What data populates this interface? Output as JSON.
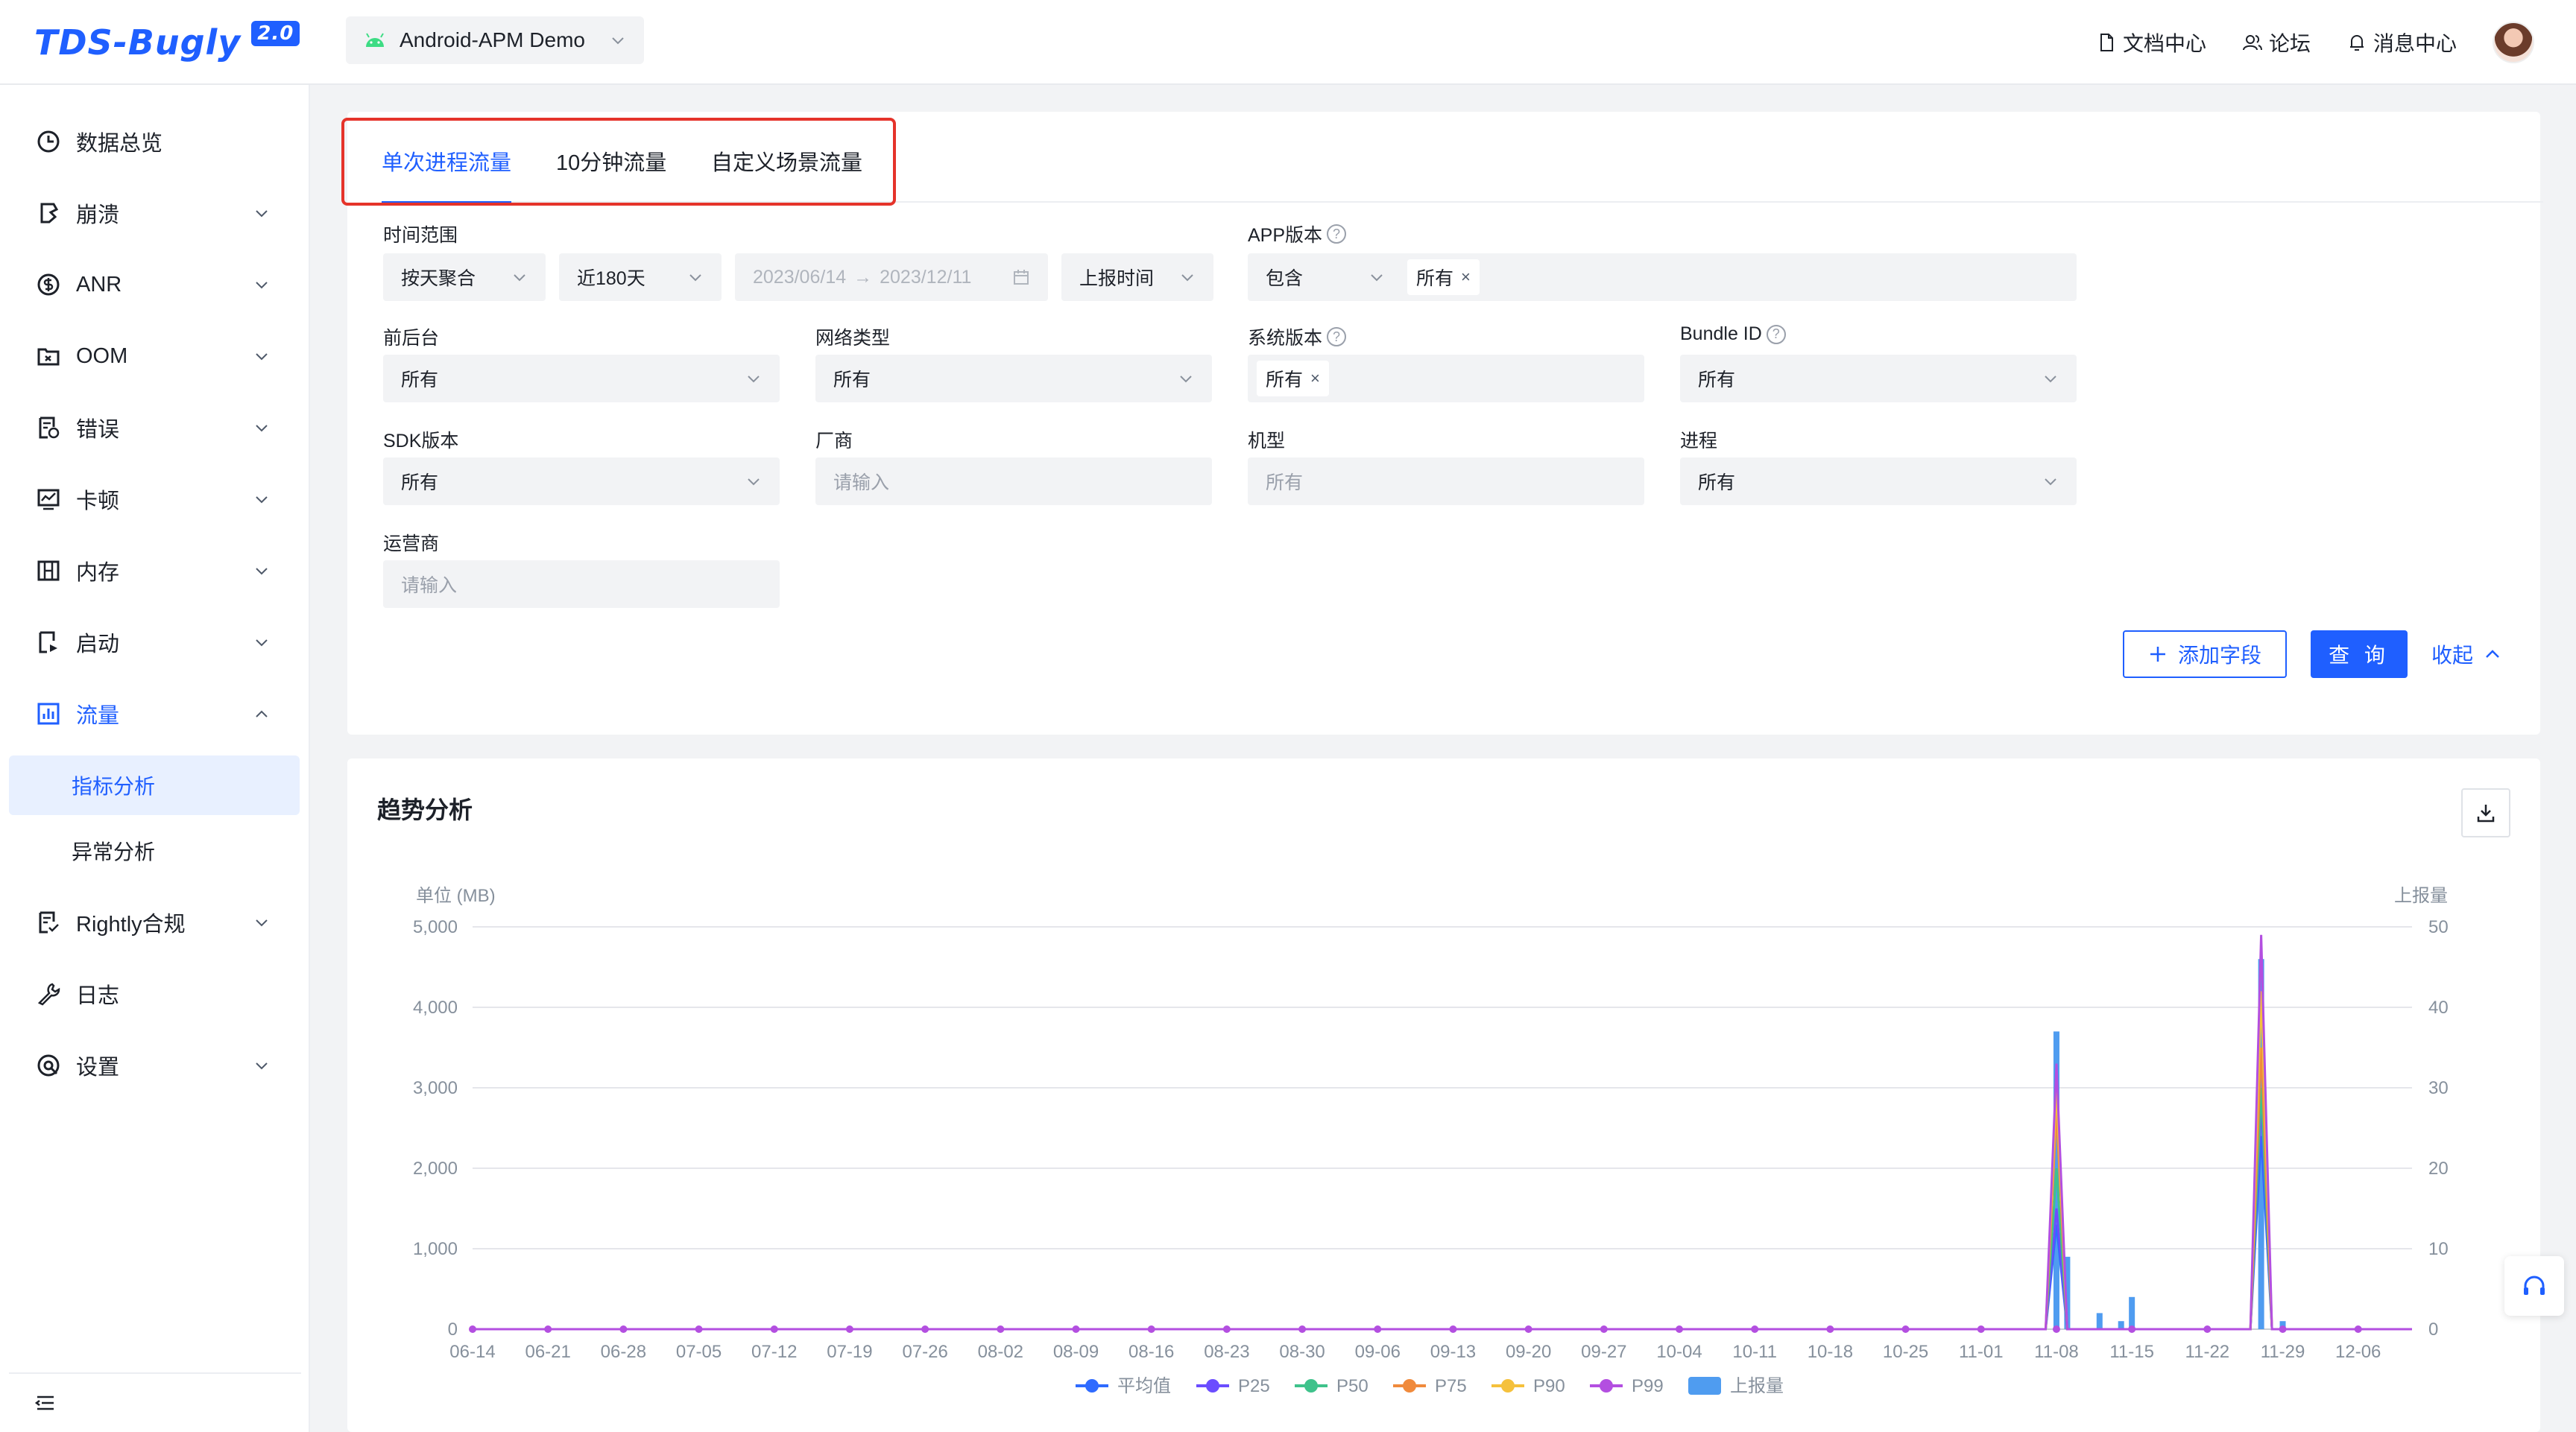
{
  "brand": {
    "name": "TDS-Bugly",
    "version": "2.0"
  },
  "app_selector": {
    "value": "Android-APM Demo"
  },
  "header_links": [
    {
      "label": "文档中心",
      "icon": "document-icon"
    },
    {
      "label": "论坛",
      "icon": "forum-icon"
    },
    {
      "label": "消息中心",
      "icon": "bell-icon"
    }
  ],
  "sidebar": {
    "items": [
      {
        "label": "数据总览",
        "icon": "clock-icon",
        "caret": false
      },
      {
        "label": "崩溃",
        "icon": "crash-icon",
        "caret": "down"
      },
      {
        "label": "ANR",
        "icon": "anr-icon",
        "caret": "down"
      },
      {
        "label": "OOM",
        "icon": "oom-icon",
        "caret": "down"
      },
      {
        "label": "错误",
        "icon": "error-icon",
        "caret": "down"
      },
      {
        "label": "卡顿",
        "icon": "lag-icon",
        "caret": "down"
      },
      {
        "label": "内存",
        "icon": "memory-icon",
        "caret": "down"
      },
      {
        "label": "启动",
        "icon": "launch-icon",
        "caret": "down"
      },
      {
        "label": "流量",
        "icon": "traffic-icon",
        "caret": "up",
        "active": true
      }
    ],
    "sub_items": [
      {
        "label": "指标分析",
        "active": true
      },
      {
        "label": "异常分析",
        "active": false
      }
    ],
    "items_after": [
      {
        "label": "Rightly合规",
        "icon": "compliance-icon",
        "caret": "down"
      },
      {
        "label": "日志",
        "icon": "wrench-icon",
        "caret": false
      },
      {
        "label": "设置",
        "icon": "settings-icon",
        "caret": "down"
      }
    ]
  },
  "tabs": [
    {
      "label": "单次进程流量",
      "active": true
    },
    {
      "label": "10分钟流量",
      "active": false
    },
    {
      "label": "自定义场景流量",
      "active": false
    }
  ],
  "filters": {
    "time_range": {
      "label": "时间范围",
      "aggregation": "按天聚合",
      "preset": "近180天",
      "start": "2023/06/14",
      "arrow": "→",
      "end": "2023/12/11",
      "time_type": "上报时间"
    },
    "app_version": {
      "label": "APP版本",
      "operator": "包含",
      "tag": "所有"
    },
    "foreground": {
      "label": "前后台",
      "value": "所有"
    },
    "network": {
      "label": "网络类型",
      "value": "所有"
    },
    "os_version": {
      "label": "系统版本",
      "tag": "所有"
    },
    "bundle_id": {
      "label": "Bundle ID",
      "value": "所有"
    },
    "sdk_version": {
      "label": "SDK版本",
      "value": "所有"
    },
    "vendor": {
      "label": "厂商",
      "placeholder": "请输入"
    },
    "model": {
      "label": "机型",
      "placeholder": "所有"
    },
    "process": {
      "label": "进程",
      "value": "所有"
    },
    "carrier": {
      "label": "运营商",
      "placeholder": "请输入"
    }
  },
  "actions": {
    "add_field": "添加字段",
    "query": "查 询",
    "collapse": "收起"
  },
  "trend": {
    "title": "趋势分析"
  },
  "chart_data": {
    "type": "line",
    "left_axis_label": "单位 (MB)",
    "right_axis_label": "上报量",
    "ylim_left": [
      0,
      5000
    ],
    "ylim_right": [
      0,
      50
    ],
    "left_ticks": [
      "0",
      "1,000",
      "2,000",
      "3,000",
      "4,000",
      "5,000"
    ],
    "right_ticks": [
      "0",
      "10",
      "20",
      "30",
      "40",
      "50"
    ],
    "x_labels": [
      "06-14",
      "06-21",
      "06-28",
      "07-05",
      "07-12",
      "07-19",
      "07-26",
      "08-02",
      "08-09",
      "08-16",
      "08-23",
      "08-30",
      "09-06",
      "09-13",
      "09-20",
      "09-27",
      "10-04",
      "10-11",
      "10-18",
      "10-25",
      "11-01",
      "11-08",
      "11-15",
      "11-22",
      "11-29",
      "12-06"
    ],
    "legend_position": "bottom",
    "series": [
      {
        "name": "平均值",
        "color": "#2f6bff",
        "spikes": [
          {
            "day": 147,
            "value": 1300
          },
          {
            "day": 166,
            "value": 2400
          }
        ]
      },
      {
        "name": "P25",
        "color": "#6b4dff",
        "spikes": [
          {
            "day": 147,
            "value": 1500
          },
          {
            "day": 166,
            "value": 2800
          }
        ]
      },
      {
        "name": "P50",
        "color": "#3fc28b",
        "spikes": [
          {
            "day": 147,
            "value": 2000
          },
          {
            "day": 166,
            "value": 3000
          }
        ]
      },
      {
        "name": "P75",
        "color": "#f08a3c",
        "spikes": [
          {
            "day": 147,
            "value": 2700
          },
          {
            "day": 166,
            "value": 3500
          }
        ]
      },
      {
        "name": "P90",
        "color": "#f5c13c",
        "spikes": [
          {
            "day": 147,
            "value": 3000
          },
          {
            "day": 166,
            "value": 4200
          }
        ]
      },
      {
        "name": "P99",
        "color": "#b34fe0",
        "spikes": [
          {
            "day": 147,
            "value": 3300
          },
          {
            "day": 166,
            "value": 4900
          }
        ]
      }
    ],
    "bars": {
      "name": "上报量",
      "color": "#4f9cf0",
      "values": [
        {
          "day": 147,
          "value": 37
        },
        {
          "day": 148,
          "value": 9
        },
        {
          "day": 151,
          "value": 2
        },
        {
          "day": 153,
          "value": 1
        },
        {
          "day": 154,
          "value": 4
        },
        {
          "day": 166,
          "value": 46
        },
        {
          "day": 168,
          "value": 1
        }
      ]
    },
    "total_days": 181,
    "marker_every_days": 7
  }
}
